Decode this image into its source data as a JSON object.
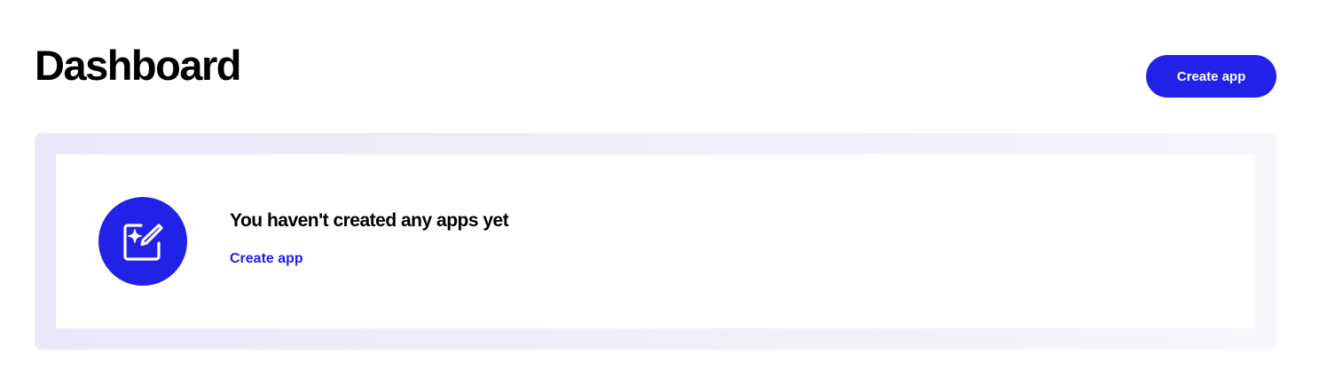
{
  "header": {
    "title": "Dashboard",
    "create_button_label": "Create app"
  },
  "empty_state": {
    "icon": "sparkle-edit-icon",
    "message": "You haven't created any apps yet",
    "link_label": "Create app"
  },
  "colors": {
    "accent": "#2121e8",
    "panel_background": "#eeedfa",
    "text": "#000000"
  }
}
